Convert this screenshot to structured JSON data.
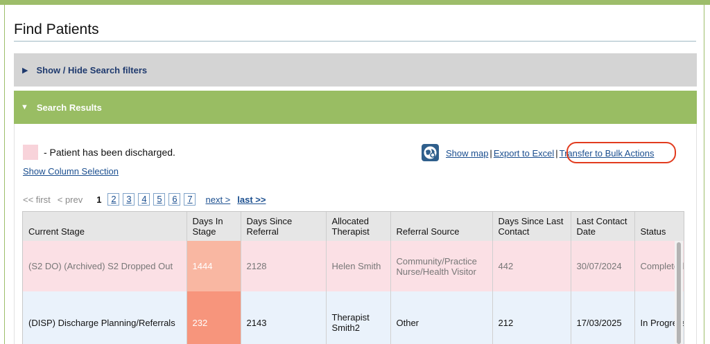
{
  "page": {
    "title": "Find Patients"
  },
  "filters": {
    "label": "Show / Hide Search filters"
  },
  "results": {
    "label": "Search Results"
  },
  "legend": {
    "text": "- Patient has been discharged.",
    "swatch_color": "#f8d3da"
  },
  "column_selection": "Show Column Selection",
  "toolbar": {
    "map": "Show map",
    "sep": "|",
    "excel": "Export to Excel",
    "bulk": "Transfer to Bulk Actions"
  },
  "pager": {
    "first": "<< first",
    "prev": "< prev",
    "current": "1",
    "pages": [
      "2",
      "3",
      "4",
      "5",
      "6",
      "7"
    ],
    "next": "next >",
    "last": "last >>"
  },
  "table": {
    "headers": [
      "Current Stage",
      "Days In Stage",
      "Days Since Referral",
      "Allocated Therapist",
      "Referral Source",
      "Days Since Last Contact",
      "Last Contact Date",
      "Status"
    ],
    "rows": [
      [
        "(S2 DO) (Archived) S2 Dropped Out",
        "1444",
        "2128",
        "Helen Smith",
        "Community/Practice Nurse/Health Visitor",
        "442",
        "30/07/2024",
        "Completed"
      ],
      [
        "(DISP) Discharge Planning/Referrals",
        "232",
        "2143",
        "Therapist Smith2",
        "Other",
        "212",
        "17/03/2025",
        "In Progress"
      ]
    ]
  },
  "colors": {
    "accent_green": "#99bd63",
    "link_blue": "#1a4e8f",
    "highlight_red": "#e23b1e"
  }
}
